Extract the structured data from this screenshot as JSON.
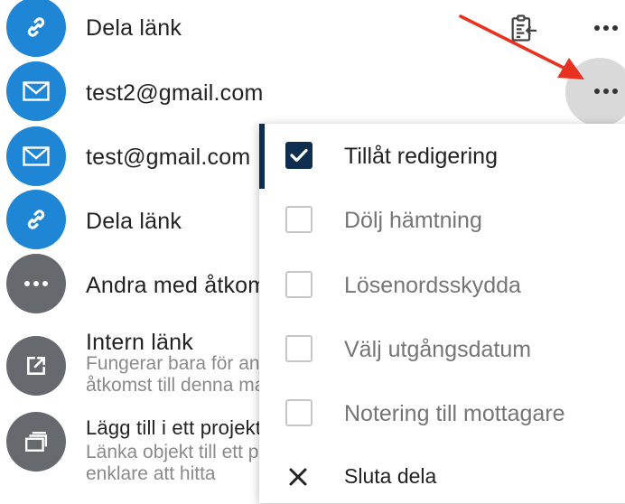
{
  "shares": [
    {
      "label": "Dela länk",
      "icon": "link-icon"
    },
    {
      "label": "test2@gmail.com",
      "icon": "mail-icon"
    },
    {
      "label": "test@gmail.com",
      "icon": "mail-icon"
    },
    {
      "label": "Dela länk",
      "icon": "link-icon"
    },
    {
      "label": "Andra med åtkomst",
      "icon": "more-icon"
    },
    {
      "label": "Intern länk",
      "sub1": "Fungerar bara för användare med",
      "sub2": "åtkomst till denna mapp",
      "icon": "external-link-icon"
    },
    {
      "label": "Lägg till i ett projekt",
      "sub1": "Länka objekt till ett projekt för att göra det",
      "sub2": "enklare att hitta",
      "icon": "projects-icon"
    }
  ],
  "menu": {
    "items": [
      {
        "label": "Tillåt redigering",
        "checked": true
      },
      {
        "label": "Dölj hämtning",
        "checked": false
      },
      {
        "label": "Lösenordsskydda",
        "checked": false
      },
      {
        "label": "Välj utgångsdatum",
        "checked": false
      },
      {
        "label": "Notering till mottagare",
        "checked": false
      }
    ],
    "stop_share_label": "Sluta dela"
  },
  "colors": {
    "accent": "#0f2d4e",
    "avatar_blue": "#1f86d6",
    "avatar_grey": "#666a6e",
    "annotation_arrow": "#e8321f"
  }
}
